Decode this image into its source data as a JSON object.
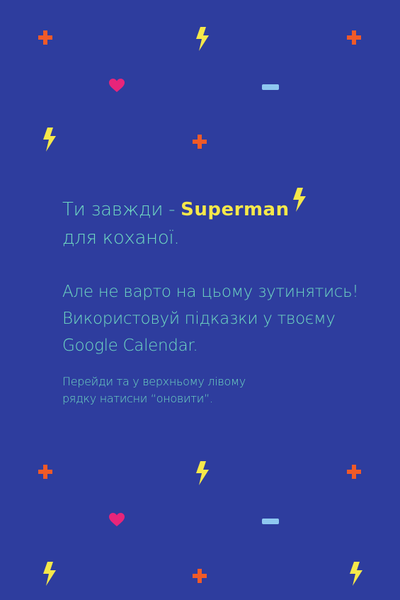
{
  "headline": {
    "line1_prefix": "Ти завжди  - ",
    "line1_highlight": "Superman",
    "line2": "для коханої."
  },
  "paragraph": {
    "line1": "Але не варто на цьому зутинятись!",
    "line2": "Використовуй підказки у твоєму",
    "line3": "Google Calendar."
  },
  "hint": {
    "line1": "Перейди та у верхньому лівому",
    "line2": "рядку натисни “оновити”."
  },
  "colors": {
    "background": "#2e3d9e",
    "text": "#6fd8c2",
    "highlight": "#f6e84a",
    "plus": "#f05a28",
    "bolt": "#f6e84a",
    "heart": "#e8257a",
    "minus": "#8ec8f0"
  },
  "icons": [
    "plus-icon",
    "lightning-bolt-icon",
    "heart-icon",
    "minus-icon"
  ]
}
